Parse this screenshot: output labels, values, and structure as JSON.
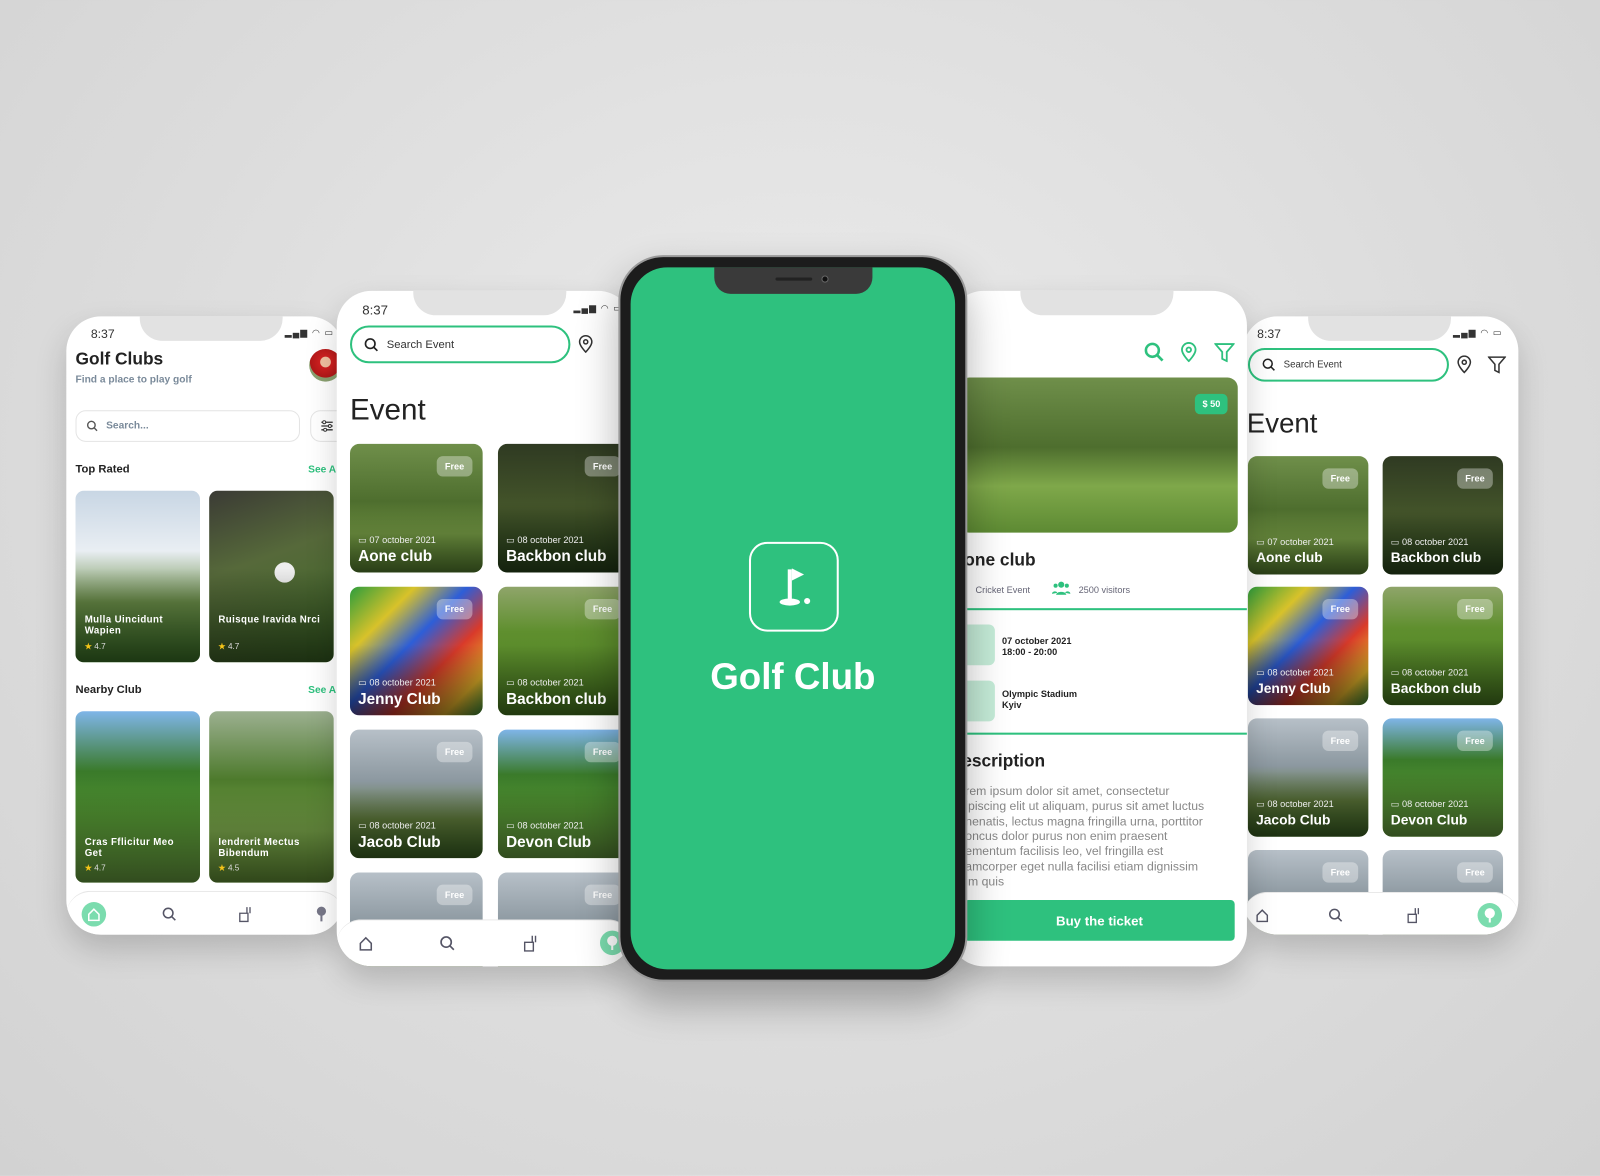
{
  "colors": {
    "brand": "#2ec17e",
    "background": "#dedede"
  },
  "status": {
    "time": "8:37"
  },
  "home_screen": {
    "title": "Golf Clubs",
    "subtitle": "Find a place to play golf",
    "search_placeholder": "Search...",
    "top_rated": {
      "heading": "Top Rated",
      "see_all": "See A",
      "items": [
        {
          "name": "Mulla Uincidunt Wapien",
          "rating": "4.7"
        },
        {
          "name": "Ruisque Iravida Nrci",
          "rating": "4.7"
        }
      ]
    },
    "nearby": {
      "heading": "Nearby Club",
      "see_all": "See A",
      "items": [
        {
          "name": "Cras Fflicitur Meo Get",
          "rating": "4.7"
        },
        {
          "name": "Iendrerit Mectus Bibendum",
          "rating": "4.5"
        }
      ]
    },
    "nav": [
      "home-icon",
      "search-icon",
      "golf-bag-icon",
      "golf-tee-icon"
    ]
  },
  "event_screen": {
    "search_placeholder": "Search Event",
    "title": "Event",
    "cards": [
      {
        "name": "Aone club",
        "date": "07 october 2021",
        "badge": "Free"
      },
      {
        "name": "Backbon club",
        "date": "08 october 2021",
        "badge": "Free"
      },
      {
        "name": "Jenny Club",
        "date": "08 october 2021",
        "badge": "Free"
      },
      {
        "name": "Backbon club",
        "date": "08 october 2021",
        "badge": "Free"
      },
      {
        "name": "Jacob Club",
        "date": "08 october 2021",
        "badge": "Free"
      },
      {
        "name": "Devon Club",
        "date": "08 october 2021",
        "badge": "Free"
      },
      {
        "name": "",
        "date": "",
        "badge": "Free"
      },
      {
        "name": "",
        "date": "",
        "badge": "Free"
      }
    ]
  },
  "splash": {
    "title": "Golf Club",
    "icon": "golf-flag-icon"
  },
  "detail_screen": {
    "price": "$ 50",
    "title": "one club",
    "category": "Cricket Event",
    "visitors": "2500 visitors",
    "date": "07 october 2021",
    "time": "18:00 - 20:00",
    "venue": "Olympic Stadium",
    "city": "Kyiv",
    "description_heading": "escription",
    "description_lines": [
      "rem ipsum dolor sit amet, consectetur",
      "ipiscing elit ut aliquam, purus sit amet luctus",
      "nenatis, lectus magna fringilla urna, porttitor",
      "oncus dolor purus non enim praesent",
      "ementum facilisis leo, vel fringilla est",
      "amcorper eget nulla facilisi etiam dignissim",
      "im quis"
    ],
    "buy_label": "Buy the ticket"
  }
}
